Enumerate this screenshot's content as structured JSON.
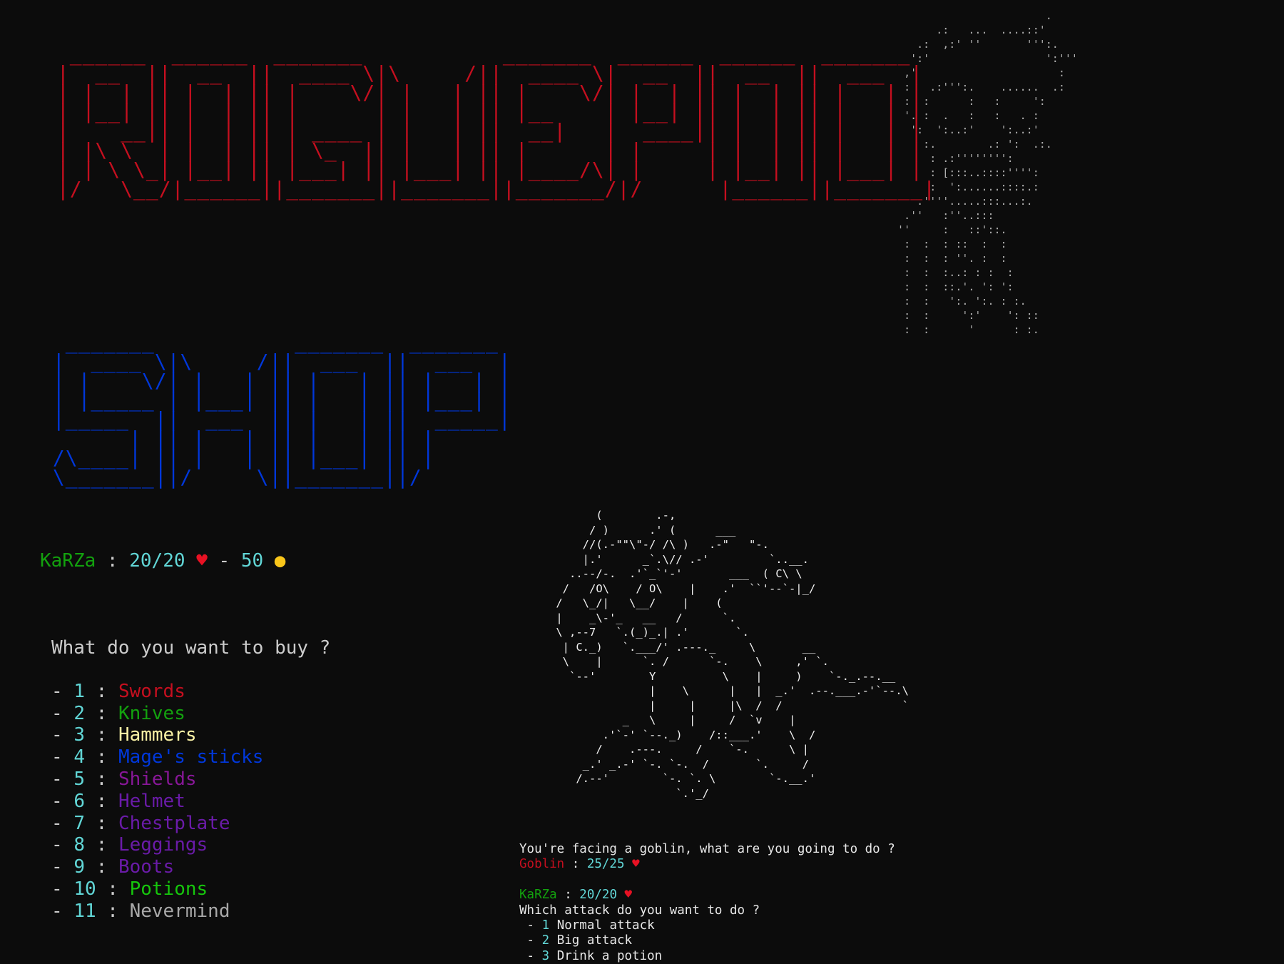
{
  "colors": {
    "background": "#0c0c0c",
    "logo_rogue": "#c50f1f",
    "logo_shop": "#0037da",
    "player_name": "#13a10e",
    "numbers": "#61d6d6",
    "enemy_name": "#c50f1f",
    "heart": "#e81123"
  },
  "icons": {
    "heart": "heart-icon",
    "coin": "coin-icon"
  },
  "ascii": {
    "rogue_title": "  ______  ______  _______           _______  ______  ______  _______\n |  __  ||  __  ||  ____ \\|\\     /||  ____ \\|  __  ||  __  ||  ___  |\n | |  | || |  | || |    \\/| |   | || |    \\/| |  | || |  | || |   | |\n | |__| || |  | || |      | |   | || |__    | |__| || |  | || |   | |\n |    __|| |  | || | ____ | |   | ||  __|   |  ____|| |  | || |   | |\n | |\\ \\  | |  | || | \\_  || |   | || |      | |     | |  | || |   | |\n | | \\ \\_| |__| || |___| || |___| || |____/\\| |     | |__| || |___| |\n |/   \\__/|______||_______||_______||_______/|/      |______||_______|",
    "shop_title": "  _______           _______  _______\n |  ____ \\|\\     /||  ___  ||  ___  |\n | |    \\/| |   | || |   | || |   | |\n | |_____ | |___| || |   | || |___| |\n |_____  ||  ___  || |   | ||  _____|\n       | || |   | || |   | || |\n /\\____| || |   | || |___| || |\n \\_______||/     \\||_______||/",
    "skeleton": "                         .\n        .:   ...  ....::'\n     .:  ,:' ''       ''':.\n    ':'                  ':'''\n   ,'                      :\n   :   .:''':.    ......  .:\n   :  :      :   :     ':\n   '. :  .   :   :   . :\n    ':  ':..:'    ':..:'\n      :.        .: ':  .:.\n       : .:'''''''':\n       : [:::..::::'''':\n       :  ':......::::.:\n     .''''.....:::...:.\n   .''   :''..:::\n  ''     :   ::'::.\n   :  :  : ::  :  :\n   :  :  : ''. :  :\n   :  :  :..: : :  :\n   :  :  ::.'. ': ':\n   :  :   ':. ':. : :.\n   :  :     ':'    ': ::\n   :  :      '      : :.",
    "goblin": "       (        .-,\n      / )      .' (      ___\n     //(.-\"\"\\\"-/ /\\ )   .-\"   \"-.\n     |.'      _`.\\// .-'         `..__.\n   ..--/-.  .'`_`'-'       ___  ( C\\ \\\n  /   /O\\    / O\\    |    .'  ``'--`-|_/\n /   \\_/|   \\__/    |    (\n |    _\\-'_   __   /      `.\n \\ ,--7   `.(_)_.| .'       `.\n  | C._)   `.___/' .---._     \\       __\n  \\    |      `. /      `-.    \\     ,' `.\n   `--'        Y          \\    |     )    `-._.--.__\n               |    \\      |   |  _.'  .--.___.-'`--.\\\n               |     |     |\\  /  /                  `\n           _   \\     |     /  `v    |\n        .'`-' `--._)    /::___.'    \\  /\n       /    .---.     /    `-.      \\ |\n     _.' _.-' `-. `-.  /       `.     /\n    /.--'        `-. `. \\        `-.__.'\n                   `.'_/"
  },
  "player": {
    "name": "KaRZa",
    "hp": "20/20",
    "gold": "50",
    "sep1": " : ",
    "sep2": " - "
  },
  "shop": {
    "question": "What do you want to buy ?",
    "items": [
      {
        "num": "1",
        "label": "Swords",
        "color": "#c50f1f"
      },
      {
        "num": "2",
        "label": "Knives",
        "color": "#13a10e"
      },
      {
        "num": "3",
        "label": "Hammers",
        "color": "#f9f1a5"
      },
      {
        "num": "4",
        "label": "Mage's sticks",
        "color": "#0037da"
      },
      {
        "num": "5",
        "label": "Shields",
        "color": "#881798"
      },
      {
        "num": "6",
        "label": "Helmet",
        "color": "#6a1ba8"
      },
      {
        "num": "7",
        "label": "Chestplate",
        "color": "#6a1ba8"
      },
      {
        "num": "8",
        "label": "Leggings",
        "color": "#6a1ba8"
      },
      {
        "num": "9",
        "label": "Boots",
        "color": "#6a1ba8"
      },
      {
        "num": "10",
        "label": "Potions",
        "color": "#16c60c"
      },
      {
        "num": "11",
        "label": "Nevermind",
        "color": "#a8a8a8"
      }
    ]
  },
  "combat": {
    "intro": "You're facing a goblin, what are you going to do ?",
    "enemy_name": "Goblin",
    "enemy_hp": "25/25",
    "player_name": "KaRZa",
    "player_hp": "20/20",
    "attack_question": "Which attack do you want to do ?",
    "options": [
      {
        "num": "1",
        "label": "Normal attack"
      },
      {
        "num": "2",
        "label": "Big attack"
      },
      {
        "num": "3",
        "label": "Drink a potion"
      }
    ]
  }
}
